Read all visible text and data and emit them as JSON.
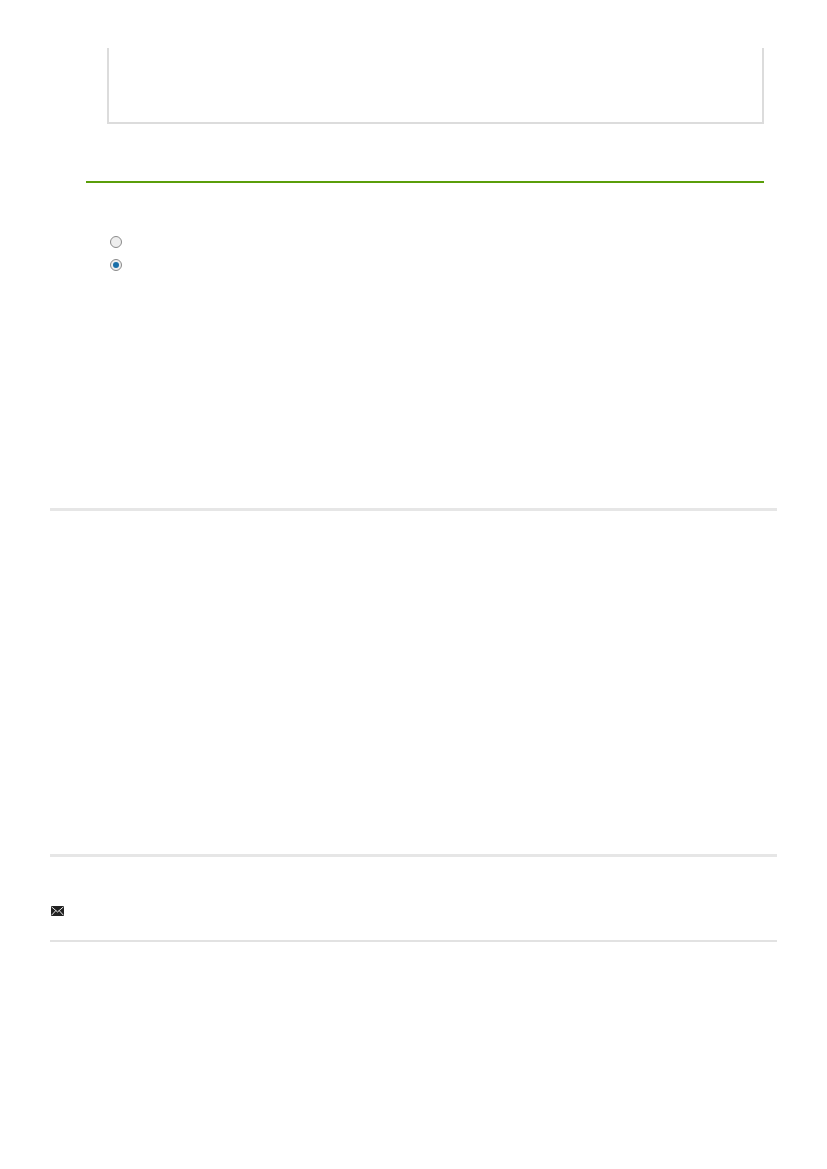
{
  "radio_options": [
    {
      "selected": false
    },
    {
      "selected": true
    }
  ]
}
